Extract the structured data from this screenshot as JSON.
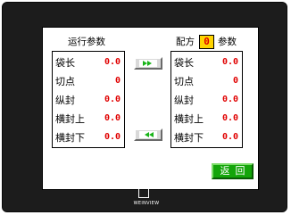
{
  "left_panel": {
    "title": "运行参数",
    "rows": [
      {
        "label": "袋长",
        "value": "0.0"
      },
      {
        "label": "切点",
        "value": "0"
      },
      {
        "label": "纵封",
        "value": "0.0"
      },
      {
        "label": "横封上",
        "value": "0.0"
      },
      {
        "label": "横封下",
        "value": "0.0"
      }
    ]
  },
  "right_panel": {
    "title_prefix": "配方",
    "recipe_number": "0",
    "title_suffix": "参数",
    "rows": [
      {
        "label": "袋长",
        "value": "0.0"
      },
      {
        "label": "切点",
        "value": "0"
      },
      {
        "label": "纵封",
        "value": "0.0"
      },
      {
        "label": "横封上",
        "value": "0.0"
      },
      {
        "label": "横封下",
        "value": "0.0"
      }
    ]
  },
  "buttons": {
    "copy_right_icon": "double-arrow-right-icon",
    "copy_left_icon": "double-arrow-left-icon",
    "return_label": "返回"
  },
  "brand": {
    "logo_icon": "weinview-logo-icon",
    "text": "WEINVIEW"
  },
  "colors": {
    "value_text": "#e00000",
    "arrow": "#19b419",
    "return_button": "#14a50a",
    "recipe_box": "#ffd400"
  }
}
